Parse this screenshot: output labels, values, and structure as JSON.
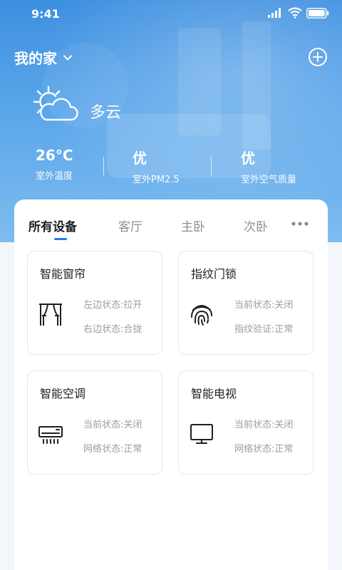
{
  "status_bar": {
    "time": "9:41"
  },
  "header": {
    "home_name": "我的家"
  },
  "weather": {
    "condition": "多云",
    "stats": [
      {
        "value": "26°C",
        "label": "室外温度"
      },
      {
        "value": "优",
        "label": "室外PM2.5"
      },
      {
        "value": "优",
        "label": "室外空气质量"
      }
    ]
  },
  "tabs": [
    {
      "label": "所有设备",
      "active": true
    },
    {
      "label": "客厅"
    },
    {
      "label": "主卧"
    },
    {
      "label": "次卧"
    }
  ],
  "devices": [
    {
      "name": "智能窗帘",
      "icon": "curtain-icon",
      "line1": "左边状态:拉开",
      "line2": "右边状态:合拢"
    },
    {
      "name": "指纹门锁",
      "icon": "fingerprint-icon",
      "line1": "当前状态:关闭",
      "line2": "指纹验证:正常"
    },
    {
      "name": "智能空调",
      "icon": "air-conditioner-icon",
      "line1": "当前状态:关闭",
      "line2": "网络状态:正常"
    },
    {
      "name": "智能电视",
      "icon": "tv-icon",
      "line1": "当前状态:关闭",
      "line2": "网络状态:正常"
    }
  ],
  "colors": {
    "accent": "#1f7ef0",
    "hero_top": "#3d8fe0",
    "hero_bottom": "#7ebcf0"
  }
}
